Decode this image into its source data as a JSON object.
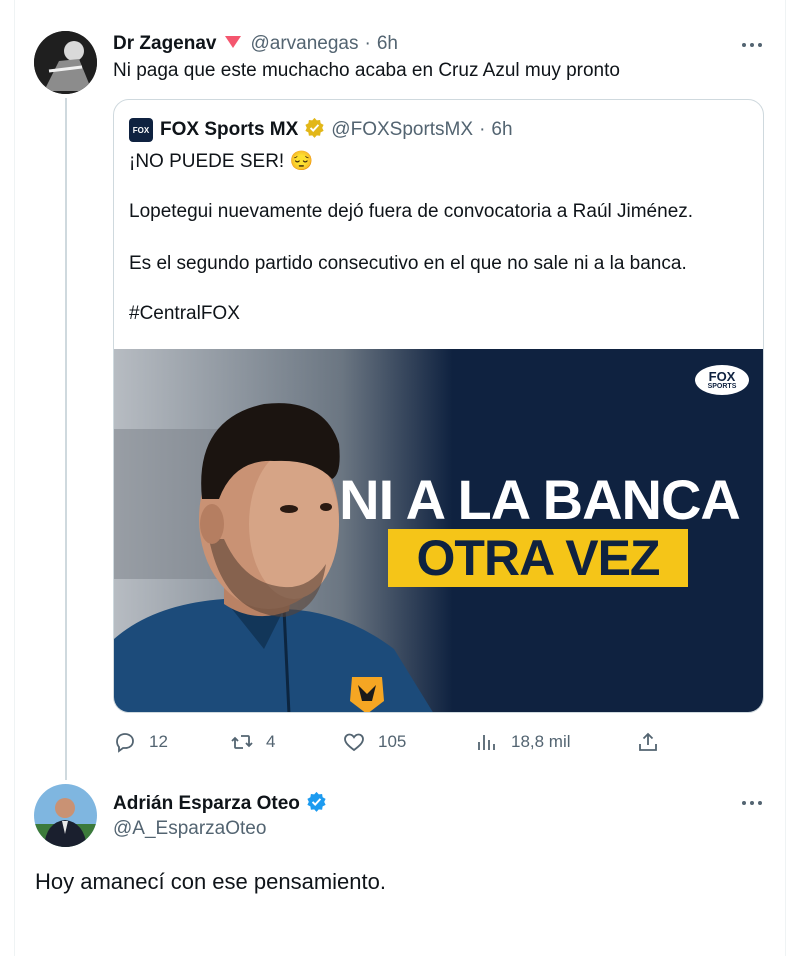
{
  "tweet": {
    "author_name": "Dr Zagenav",
    "handle": "@arvanegas",
    "separator": "·",
    "time": "6h",
    "text": "Ni paga que este muchacho acaba en Cruz Azul muy pronto"
  },
  "quote": {
    "author_name": "FOX Sports MX",
    "handle": "@FOXSportsMX",
    "separator": "·",
    "time": "6h",
    "line1": "¡NO PUEDE SER! 😔",
    "line2": "Lopetegui nuevamente dejó fuera de convocatoria a Raúl Jiménez.",
    "line3": "Es el segundo partido consecutivo en el que no sale ni a la banca.",
    "line4": "#CentralFOX",
    "logo_text": "FOX",
    "media": {
      "headline": "NI A LA BANCA",
      "subheadline": "OTRA VEZ",
      "logo_line1": "FOX",
      "logo_line2": "SPORTS",
      "bg_color": "#0f2240",
      "accent_color": "#f5c518"
    }
  },
  "actions": {
    "replies": "12",
    "reposts": "4",
    "likes": "105",
    "views": "18,8 mil"
  },
  "reply": {
    "author_name": "Adrián Esparza Oteo",
    "handle": "@A_EsparzaOteo",
    "text": "Hoy amanecí con ese pensamiento."
  },
  "icons": [
    "more-icon",
    "reply-icon",
    "repost-icon",
    "like-icon",
    "views-icon",
    "share-icon",
    "verified-badge-icon",
    "gold-verified-badge-icon",
    "pink-heart-icon"
  ],
  "colors": {
    "verified_blue": "#1d9bf0",
    "verified_gold": "#e2b719",
    "muted_text": "#536471",
    "badge_pink": "#f4566e"
  }
}
